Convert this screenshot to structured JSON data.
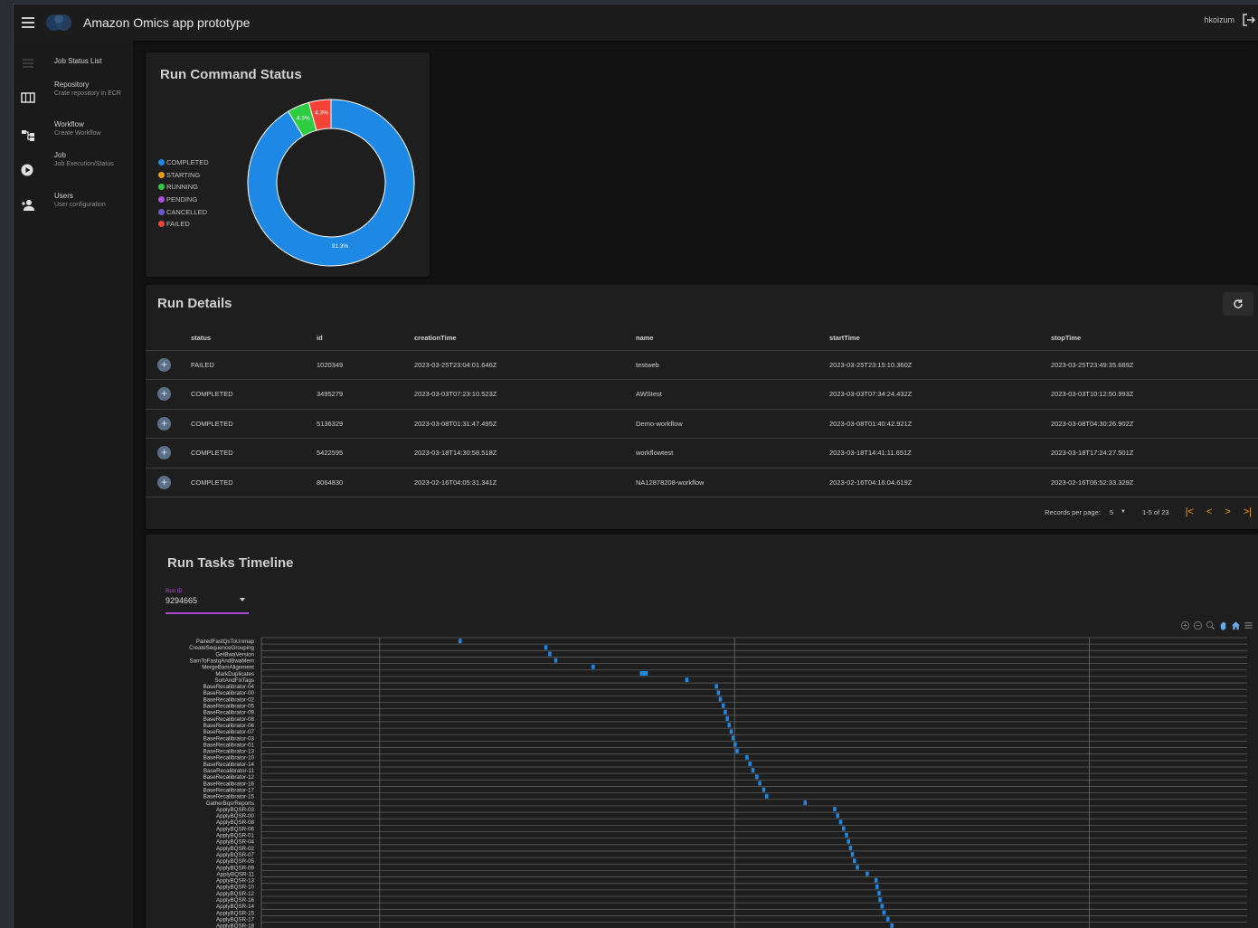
{
  "app": {
    "title": "Amazon Omics app prototype",
    "user": "hkoizum"
  },
  "sidebar": {
    "items": [
      {
        "icon": "list-icon",
        "title": "Job Status List",
        "sub": ""
      },
      {
        "icon": "table-icon",
        "title": "Repository",
        "sub": "Crate repository in ECR"
      },
      {
        "icon": "workflow-icon",
        "title": "Workflow",
        "sub": "Create Workflow"
      },
      {
        "icon": "play-circle-icon",
        "title": "Job",
        "sub": "Job Execution/Status"
      },
      {
        "icon": "users-icon",
        "title": "Users",
        "sub": "User configuration"
      }
    ]
  },
  "status_card": {
    "title": "Run Command Status",
    "chart_data": {
      "type": "pie",
      "title": "",
      "categories": [
        "COMPLETED",
        "STARTING",
        "RUNNING",
        "PENDING",
        "CANCELLED",
        "FAILED"
      ],
      "values": [
        91.3,
        0,
        4.3,
        0,
        0,
        4.3
      ],
      "labels": [
        "91.3%",
        "",
        "4.3%",
        "",
        "",
        "4.3%"
      ],
      "colors": [
        "#1e88e5",
        "#f39c12",
        "#2ecc40",
        "#b04fe0",
        "#6a5acd",
        "#f44336"
      ],
      "legend": "left"
    }
  },
  "details": {
    "title": "Run Details",
    "columns": [
      "status",
      "id",
      "creationTime",
      "name",
      "startTime",
      "stopTime"
    ],
    "rows": [
      [
        "FAILED",
        "1020349",
        "2023-03-25T23:04:01.646Z",
        "testweb",
        "2023-03-25T23:15:10.360Z",
        "2023-03-25T23:49:35.689Z"
      ],
      [
        "COMPLETED",
        "3495279",
        "2023-03-03T07:23:10.523Z",
        "AWStest",
        "2023-03-03T07:34:24.432Z",
        "2023-03-03T10:12:50.993Z"
      ],
      [
        "COMPLETED",
        "5136329",
        "2023-03-08T01:31:47.495Z",
        "Demo-workflow",
        "2023-03-08T01:40:42.921Z",
        "2023-03-08T04:30:26.902Z"
      ],
      [
        "COMPLETED",
        "5422595",
        "2023-03-18T14:30:58.518Z",
        "workflowtest",
        "2023-03-18T14:41:11.651Z",
        "2023-03-18T17:24:27.501Z"
      ],
      [
        "COMPLETED",
        "8064830",
        "2023-02-16T04:05:31.341Z",
        "NA12878208-workflow",
        "2023-02-16T04:16:04.619Z",
        "2023-02-16T06:52:33.329Z"
      ]
    ],
    "records_per_page_label": "Records per page:",
    "records_per_page": "5",
    "range": "1-5 of 23"
  },
  "timeline": {
    "title": "Run Tasks Timeline",
    "select_label": "Run ID",
    "select_value": "9294665",
    "tasks": [
      "PairedFastQsToUnmap",
      "CreateSequenceGrouping",
      "GetBwaVersion",
      "SamToFastqAndBwaMem",
      "MergeBamAlignment",
      "MarkDuplicates",
      "SortAndFixTags",
      "BaseRecalibrator-04",
      "BaseRecalibrator-00",
      "BaseRecalibrator-02",
      "BaseRecalibrator-05",
      "BaseRecalibrator-09",
      "BaseRecalibrator-08",
      "BaseRecalibrator-06",
      "BaseRecalibrator-07",
      "BaseRecalibrator-03",
      "BaseRecalibrator-01",
      "BaseRecalibrator-13",
      "BaseRecalibrator-10",
      "BaseRecalibrator-14",
      "BaseRecalibrator-11",
      "BaseRecalibrator-12",
      "BaseRecalibrator-16",
      "BaseRecalibrator-17",
      "BaseRecalibrator-15",
      "GatherBqsrReports",
      "ApplyBQSR-03",
      "ApplyBQSR-00",
      "ApplyBQSR-08",
      "ApplyBQSR-06",
      "ApplyBQSR-01",
      "ApplyBQSR-04",
      "ApplyBQSR-02",
      "ApplyBQSR-07",
      "ApplyBQSR-05",
      "ApplyBQSR-09",
      "ApplyBQSR-11",
      "ApplyBQSR-13",
      "ApplyBQSR-10",
      "ApplyBQSR-12",
      "ApplyBQSR-16",
      "ApplyBQSR-14",
      "ApplyBQSR-15",
      "ApplyBQSR-17",
      "ApplyBQSR-18"
    ],
    "starts": [
      0.2,
      0.287,
      0.291,
      0.297,
      0.335,
      0.384,
      0.43,
      0.46,
      0.462,
      0.464,
      0.467,
      0.469,
      0.471,
      0.473,
      0.475,
      0.477,
      0.479,
      0.481,
      0.491,
      0.494,
      0.497,
      0.501,
      0.504,
      0.508,
      0.511,
      0.55,
      0.58,
      0.583,
      0.586,
      0.589,
      0.592,
      0.594,
      0.596,
      0.598,
      0.6,
      0.603,
      0.613,
      0.622,
      0.623,
      0.625,
      0.626,
      0.628,
      0.63,
      0.634,
      0.638
    ],
    "durations": [
      0.003,
      0.003,
      0.003,
      0.003,
      0.003,
      0.008,
      0.003,
      0.003,
      0.003,
      0.003,
      0.003,
      0.003,
      0.003,
      0.003,
      0.003,
      0.003,
      0.003,
      0.003,
      0.003,
      0.003,
      0.003,
      0.003,
      0.003,
      0.003,
      0.003,
      0.003,
      0.003,
      0.003,
      0.003,
      0.003,
      0.003,
      0.003,
      0.003,
      0.003,
      0.003,
      0.003,
      0.003,
      0.003,
      0.003,
      0.003,
      0.003,
      0.003,
      0.003,
      0.003,
      0.003
    ],
    "bar_color": "#1e88e5",
    "toolbar": [
      "zoom-in-icon",
      "zoom-out-icon",
      "magnifier-icon",
      "pan-hand-icon",
      "home-icon",
      "menu-icon"
    ]
  }
}
